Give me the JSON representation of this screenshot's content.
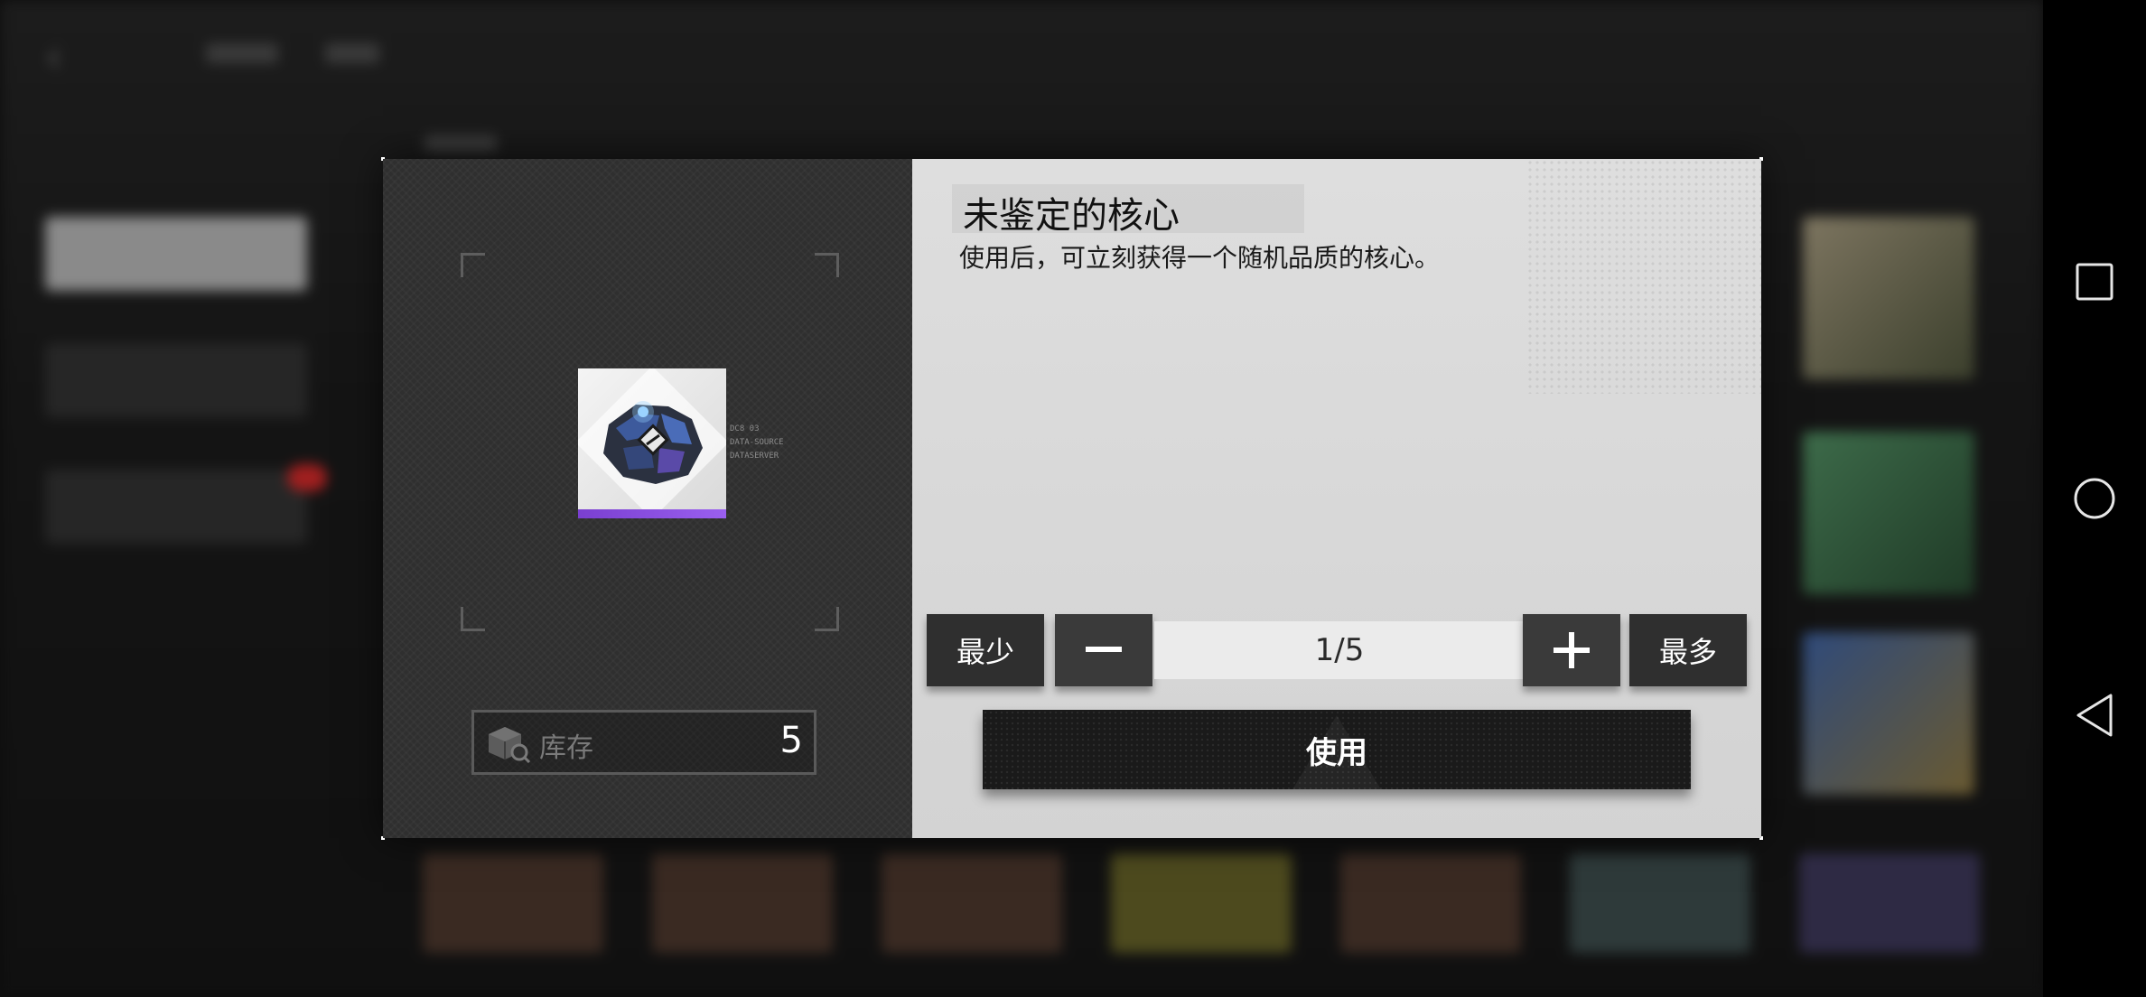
{
  "dialog": {
    "item": {
      "title": "未鉴定的核心",
      "description": "使用后，可立刻获得一个随机品质的核心。",
      "code_lines": [
        "DC8 03",
        "DATA-SOURCE",
        "DATASERVER"
      ],
      "rarity_color": "#8a4fe0"
    },
    "stock": {
      "label": "库存",
      "value": "5",
      "icon": "box-search-icon"
    },
    "quantity": {
      "min_label": "最少",
      "max_label": "最多",
      "minus_icon": "minus-icon",
      "plus_icon": "plus-icon",
      "value": "1/5"
    },
    "use_label": "使用"
  },
  "navbar": {
    "icons": [
      "recents-square-icon",
      "home-circle-icon",
      "back-triangle-icon"
    ]
  },
  "colors": {
    "left_panel": "#2f2f2f",
    "right_panel": "#d6d6d6",
    "button_dark": "#2f2f2f",
    "rarity_purple": "#8a4fe0"
  }
}
